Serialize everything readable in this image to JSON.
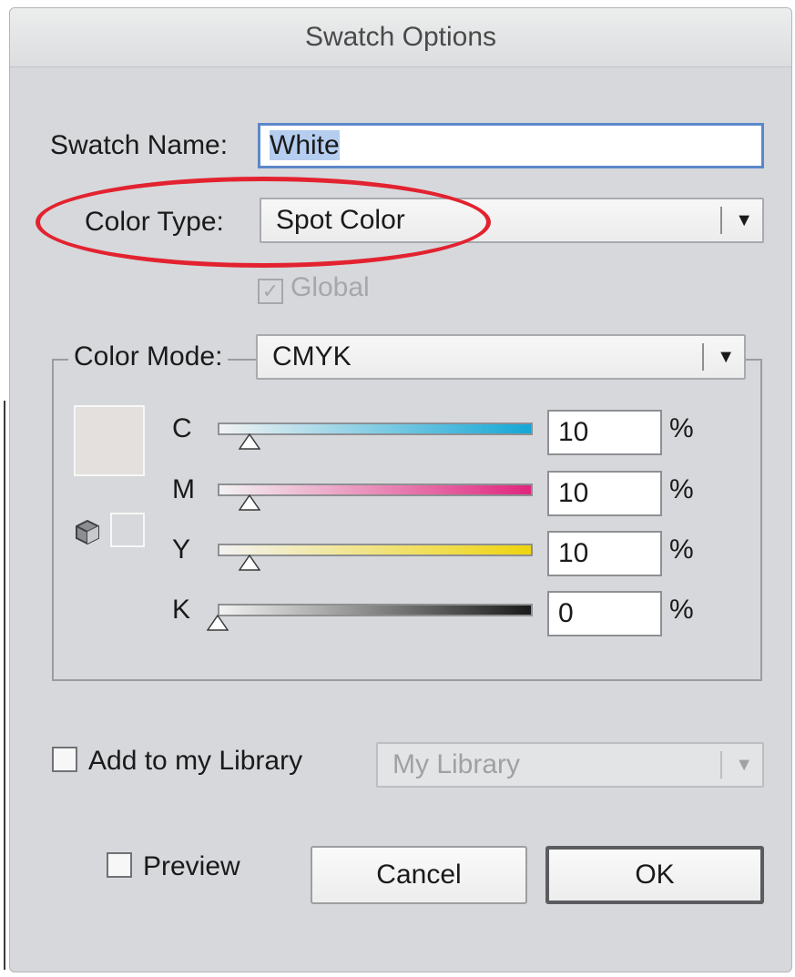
{
  "dialog": {
    "title": "Swatch Options"
  },
  "swatch_name": {
    "label": "Swatch Name:",
    "value": "White"
  },
  "color_type": {
    "label": "Color Type:",
    "value": "Spot Color"
  },
  "global": {
    "label": "Global",
    "checked": true,
    "enabled": false
  },
  "color_mode": {
    "label": "Color Mode:",
    "value": "CMYK"
  },
  "channels": [
    {
      "label": "C",
      "value": "10",
      "unit": "%",
      "fraction": 0.1,
      "gradient_end": "#14a7d6"
    },
    {
      "label": "M",
      "value": "10",
      "unit": "%",
      "fraction": 0.1,
      "gradient_end": "#e0267e"
    },
    {
      "label": "Y",
      "value": "10",
      "unit": "%",
      "fraction": 0.1,
      "gradient_end": "#efd40e"
    },
    {
      "label": "K",
      "value": "0",
      "unit": "%",
      "fraction": 0.0,
      "gradient_end": "#1a1a1a"
    }
  ],
  "colors": {
    "preview_swatch": "#e3e0dd",
    "annotation_ellipse": "#e32230",
    "focus_ring": "#5c88c9"
  },
  "library": {
    "checkbox_label": "Add to my Library",
    "checked": false,
    "select_value": "My Library",
    "enabled": false
  },
  "preview": {
    "label": "Preview",
    "checked": false
  },
  "buttons": {
    "cancel": "Cancel",
    "ok": "OK"
  },
  "icons": {
    "dropdown": "triangle-down-icon",
    "gamut": "cube-icon",
    "thumb": "slider-thumb-icon"
  }
}
